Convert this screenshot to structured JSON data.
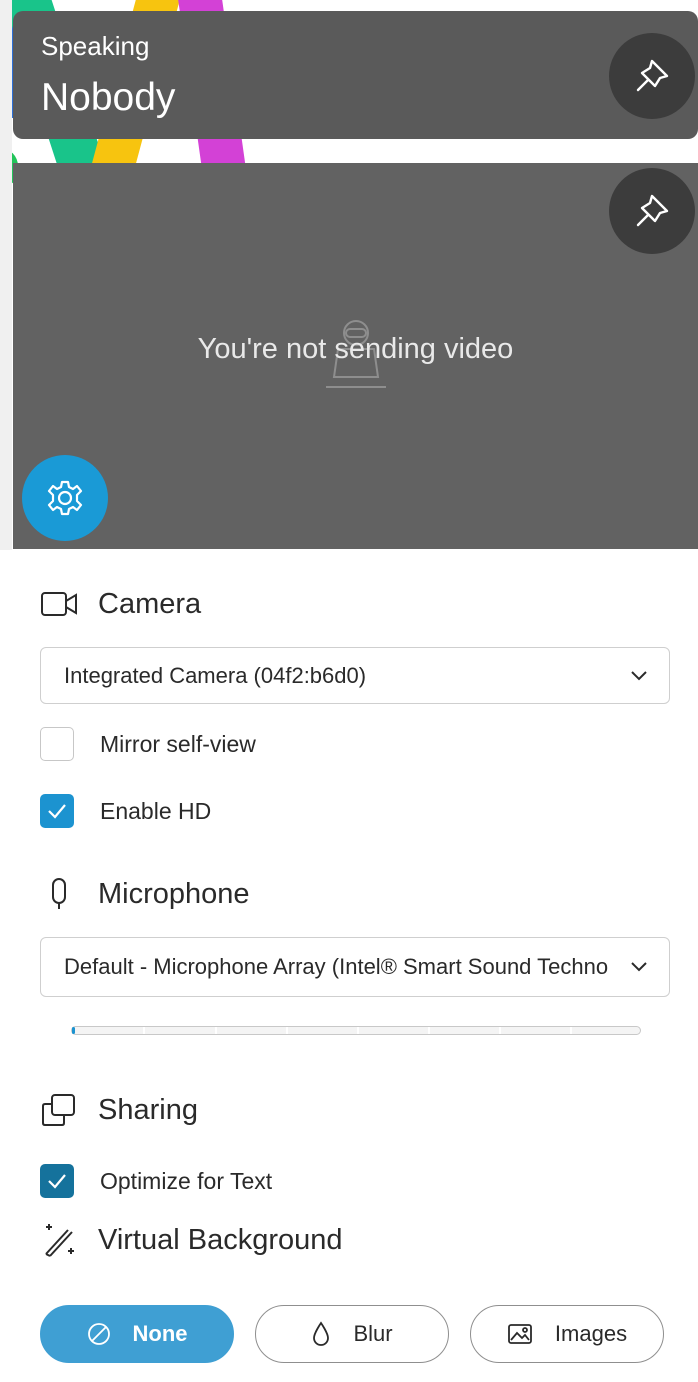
{
  "header": {
    "speaking_label": "Speaking",
    "speaker_name": "Nobody"
  },
  "video": {
    "message": "You're not sending video"
  },
  "camera": {
    "section_label": "Camera",
    "selected_device": "Integrated Camera (04f2:b6d0)",
    "mirror_label": "Mirror self-view",
    "mirror_checked": false,
    "hd_label": "Enable HD",
    "hd_checked": true
  },
  "microphone": {
    "section_label": "Microphone",
    "selected_device": "Default - Microphone Array (Intel® Smart Sound Technology",
    "level": 0.0
  },
  "sharing": {
    "section_label": "Sharing",
    "optimize_label": "Optimize for Text",
    "optimize_checked": true
  },
  "virtual_background": {
    "section_label": "Virtual Background",
    "options": [
      {
        "label": "None",
        "icon": "prohibited-icon",
        "selected": true
      },
      {
        "label": "Blur",
        "icon": "droplet-icon",
        "selected": false
      },
      {
        "label": "Images",
        "icon": "image-icon",
        "selected": false
      }
    ]
  },
  "colors": {
    "accent": "#1C93D0",
    "settings_button": "#1A9AD6",
    "card_background": "#5A5A5A",
    "video_background": "#626262"
  }
}
